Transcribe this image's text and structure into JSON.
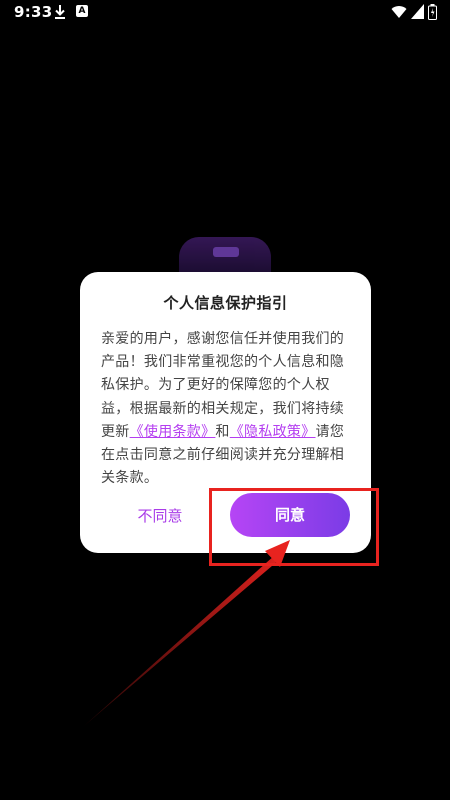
{
  "status_bar": {
    "time": "9:33",
    "icons": [
      "download-icon",
      "app-notification-icon",
      "wifi-icon",
      "signal-icon",
      "battery-icon"
    ],
    "app_icon_glyph": "A"
  },
  "dialog": {
    "title": "个人信息保护指引",
    "body_before_links": "亲爱的用户，感谢您信任并使用我们的产品！我们非常重视您的个人信息和隐私保护。为了更好的保障您的个人权益，根据最新的相关规定，我们将持续更新",
    "terms_link": "《使用条款》",
    "and_text": "和",
    "privacy_link": "《隐私政策》",
    "body_after_links": "请您在点击同意之前仔细阅读并充分理解相关条款。",
    "disagree_label": "不同意",
    "agree_label": "同意"
  },
  "colors": {
    "accent": "#b43ef0",
    "agree_gradient_start": "#b645f5",
    "agree_gradient_end": "#7b3ce6",
    "annotation_red": "#e8231f",
    "background": "#000000",
    "dialog_bg": "#ffffff"
  }
}
